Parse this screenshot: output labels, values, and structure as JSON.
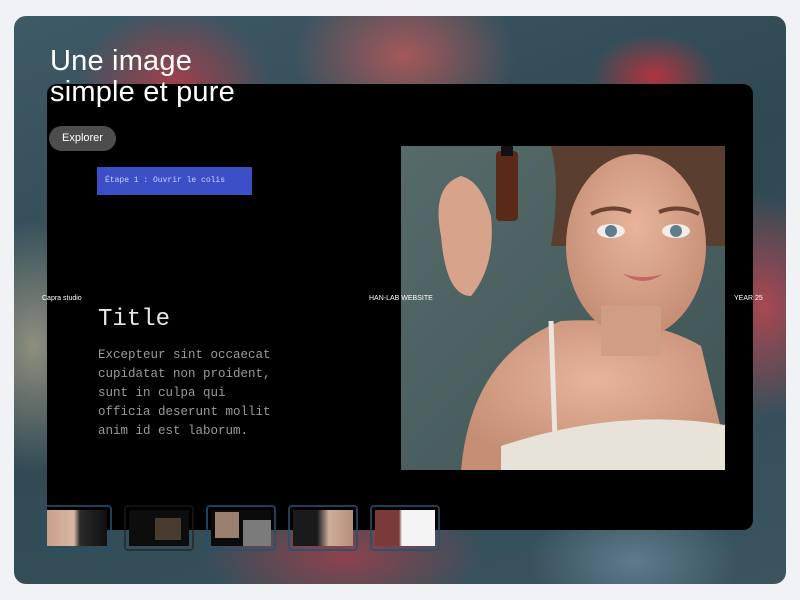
{
  "hero": {
    "title": "Une image\nsimple et pure",
    "button_label": "Explorer"
  },
  "card": {
    "step_label": "Étape 1 : Ouvrir le colis",
    "meta_left": "Capra studio",
    "meta_center": "HAN-LAB WEBSITE",
    "meta_right": "YEAR 25",
    "title": "Title",
    "body": "Excepteur sint occaecat\ncupidatat non proident,\nsunt in culpa qui\nofficia deserunt mollit\nanim id est laborum."
  },
  "thumbnails": {
    "count": 5,
    "selected_index": 0
  },
  "colors": {
    "page_bg": "#f1f2f5",
    "panel": "#000000",
    "step_chip": "#3d4fc7",
    "button_bg": "#5a5a5a"
  }
}
